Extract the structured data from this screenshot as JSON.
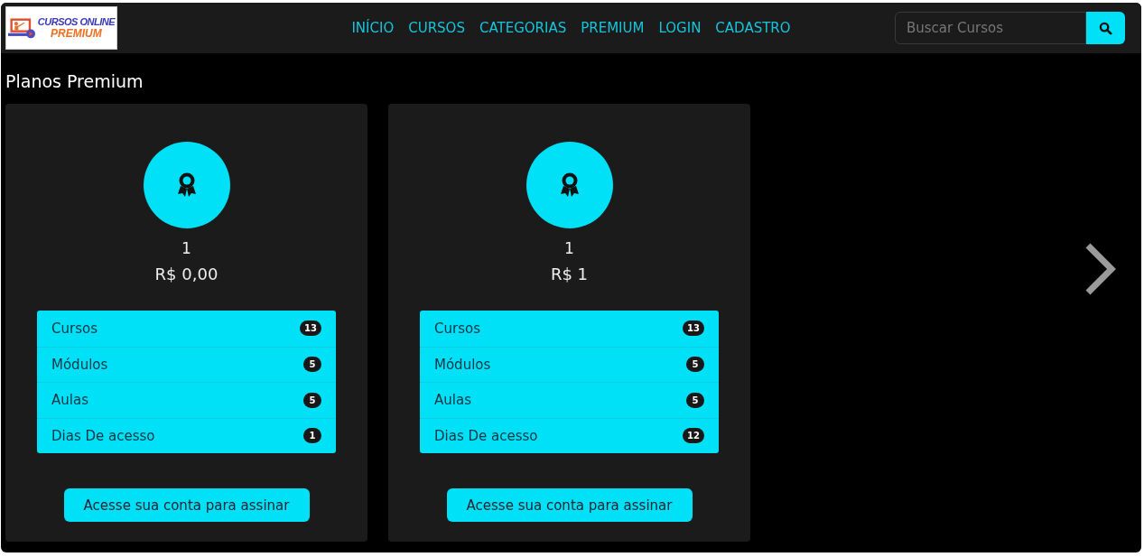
{
  "logo": {
    "line_1": "CURSOS ONLINE",
    "line_2": "PREMIUM"
  },
  "nav": [
    "INÍCIO",
    "CURSOS",
    "CATEGORIAS",
    "PREMIUM",
    "LOGIN",
    "CADASTRO"
  ],
  "search": {
    "placeholder": "Buscar Cursos"
  },
  "heading": "Planos Premium",
  "plans": [
    {
      "name": "1",
      "price": "R$ 0,00",
      "features": [
        {
          "label": "Cursos",
          "count": "13"
        },
        {
          "label": "Módulos",
          "count": "5"
        },
        {
          "label": "Aulas",
          "count": "5"
        },
        {
          "label": "Dias De acesso",
          "count": "1"
        }
      ],
      "button": "Acesse sua conta para assinar"
    },
    {
      "name": "1",
      "price": "R$ 1",
      "features": [
        {
          "label": "Cursos",
          "count": "13"
        },
        {
          "label": "Módulos",
          "count": "5"
        },
        {
          "label": "Aulas",
          "count": "5"
        },
        {
          "label": "Dias De acesso",
          "count": "12"
        }
      ],
      "button": "Acesse sua conta para assinar"
    }
  ]
}
